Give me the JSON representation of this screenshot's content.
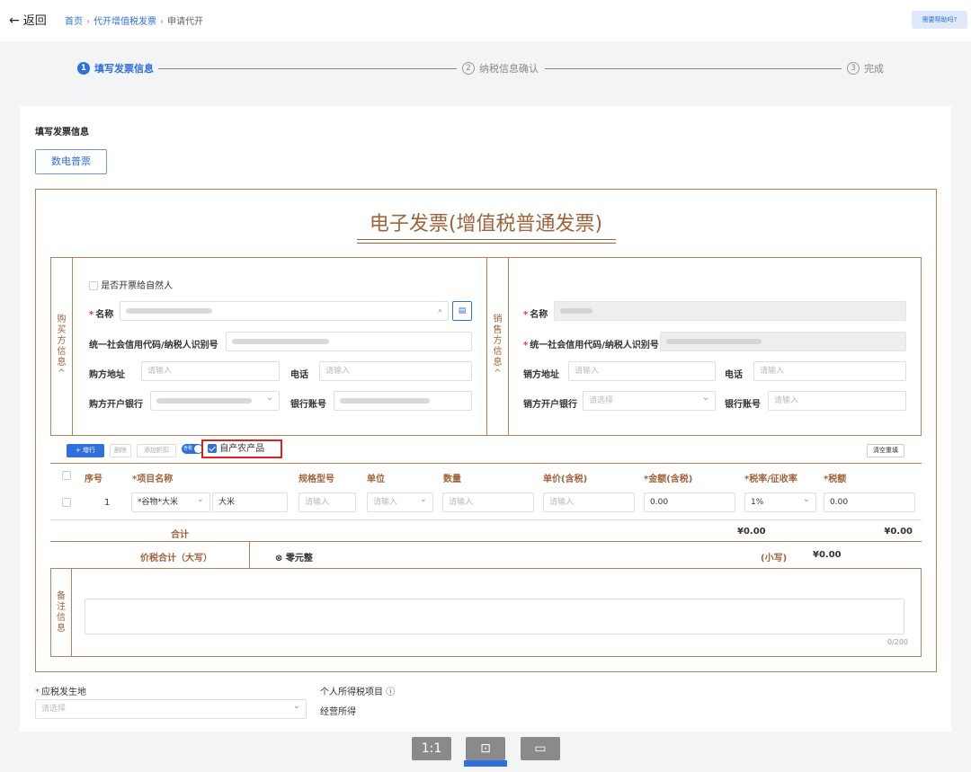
{
  "header": {
    "back_label": "返回",
    "breadcrumb": [
      "首页",
      "代开增值税发票",
      "申请代开"
    ],
    "help_label": "需要帮助吗?"
  },
  "steps": [
    {
      "num": "1",
      "label": "填写发票信息"
    },
    {
      "num": "2",
      "label": "纳税信息确认"
    },
    {
      "num": "3",
      "label": "完成"
    }
  ],
  "card": {
    "title": "填写发票信息",
    "tab_label": "数电普票"
  },
  "invoice": {
    "title": "电子发票(增值税普通发票)"
  },
  "buyer": {
    "section_label": [
      "购",
      "买",
      "方",
      "信",
      "息",
      "^"
    ],
    "natural_person_label": "是否开票给自然人",
    "name_label": "名称",
    "taxid_label": "统一社会信用代码/纳税人识别号",
    "address_label": "购方地址",
    "address_placeholder": "请输入",
    "phone_label": "电话",
    "phone_placeholder": "请输入",
    "bank_label": "购方开户银行",
    "account_label": "银行账号"
  },
  "seller": {
    "section_label": [
      "销",
      "售",
      "方",
      "信",
      "息",
      "^"
    ],
    "name_label": "名称",
    "taxid_label": "统一社会信用代码/纳税人识别号",
    "address_label": "销方地址",
    "address_placeholder": "请输入",
    "phone_label": "电话",
    "phone_placeholder": "请输入",
    "bank_label": "销方开户银行",
    "bank_placeholder": "请选择",
    "account_label": "银行账号",
    "account_placeholder": "请输入"
  },
  "toolbar": {
    "add_label": "+ 增行",
    "delete_label": "删除",
    "discount_label": "添加折扣",
    "tax_toggle_label": "含税",
    "self_produced_label": "自产农产品",
    "clear_label": "清空重填"
  },
  "items": {
    "headers": [
      "序号",
      "*项目名称",
      "规格型号",
      "单位",
      "数量",
      "单价(含税)",
      "*金额(含税)",
      "*税率/征收率",
      "*税额"
    ],
    "row": {
      "index": "1",
      "category": "*谷物*大米",
      "name": "大米",
      "spec_placeholder": "请输入",
      "unit_placeholder": "请输入",
      "qty_placeholder": "请输入",
      "price_placeholder": "请输入",
      "amount": "0.00",
      "rate": "1%",
      "tax": "0.00"
    },
    "total_label": "合计",
    "total_amount": "¥0.00",
    "total_tax": "¥0.00"
  },
  "summary": {
    "label": "价税合计（大写）",
    "upper": "⊗ 零元整",
    "lower_label": "(小写)",
    "lower": "¥0.00"
  },
  "remark": {
    "section_label": [
      "备",
      "注",
      "信",
      "息"
    ],
    "counter": "0/200"
  },
  "footer": {
    "place_label": "应税发生地",
    "place_placeholder": "请选择",
    "income_label": "个人所得税项目",
    "income_value": "经营所得"
  },
  "dock": [
    "1:1",
    "",
    ""
  ]
}
